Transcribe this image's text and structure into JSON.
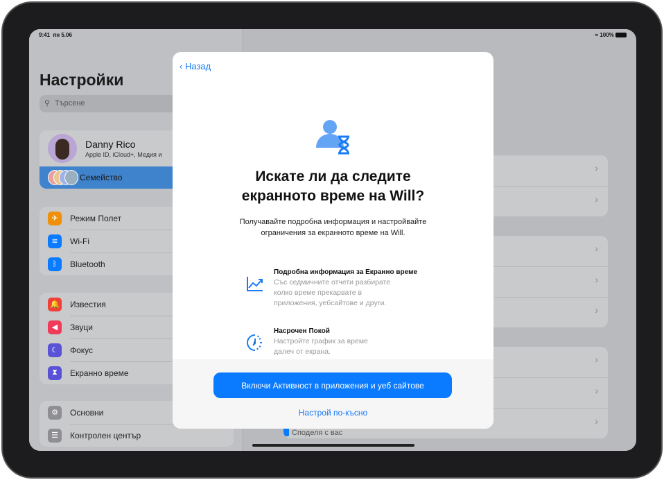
{
  "status": {
    "time": "9:41",
    "date": "пн 5.06",
    "battery": "100%"
  },
  "sidebar": {
    "title": "Настройки",
    "search_placeholder": "Търсене",
    "profile": {
      "name": "Danny Rico",
      "subtitle": "Apple ID, iCloud+, Медия и"
    },
    "family": "Семейство",
    "groups": [
      [
        {
          "label": "Режим Полет",
          "icon": "airplane-icon",
          "color": "#f0900a",
          "glyph": "✈"
        },
        {
          "label": "Wi-Fi",
          "icon": "wifi-icon",
          "color": "#0a7aff",
          "glyph": "≋"
        },
        {
          "label": "Bluetooth",
          "icon": "bluetooth-icon",
          "color": "#0a7aff",
          "glyph": "ᛒ"
        }
      ],
      [
        {
          "label": "Известия",
          "icon": "bell-icon",
          "color": "#f0403a",
          "glyph": "🔔"
        },
        {
          "label": "Звуци",
          "icon": "speaker-icon",
          "color": "#f03a5a",
          "glyph": "◀"
        },
        {
          "label": "Фокус",
          "icon": "moon-icon",
          "color": "#5a52d6",
          "glyph": "☾"
        },
        {
          "label": "Екранно време",
          "icon": "hourglass-icon",
          "color": "#5a52d6",
          "glyph": "⧗"
        }
      ],
      [
        {
          "label": "Основни",
          "icon": "gear-icon",
          "color": "#8e8e93",
          "glyph": "⚙"
        },
        {
          "label": "Контролен център",
          "icon": "switches-icon",
          "color": "#8e8e93",
          "glyph": "☰"
        }
      ]
    ]
  },
  "right": {
    "last_row": "Споделя с вас"
  },
  "modal": {
    "back": "Назад",
    "title_line1": "Искате ли да следите",
    "title_line2": "екранното време на Will?",
    "description_line1": "Получавайте подробна информация и настройвайте",
    "description_line2": "ограничения за екранното време на Will.",
    "features": [
      {
        "title": "Подробна информация за Екранно време",
        "lines": [
          "Със седмичните отчети разбирате",
          "колко време прекарвате в",
          "приложения, уебсайтове и други."
        ],
        "icon": "chart-icon"
      },
      {
        "title": "Насрочен Покой",
        "lines": [
          "Настройте график за време",
          "далеч от екрана."
        ],
        "icon": "downtime-icon"
      }
    ],
    "primary_button": "Включи Активност в приложения и уеб сайтове",
    "secondary_button": "Настрой по-късно"
  },
  "colors": {
    "accent": "#0a7aff",
    "selected": "#3f83cc"
  }
}
